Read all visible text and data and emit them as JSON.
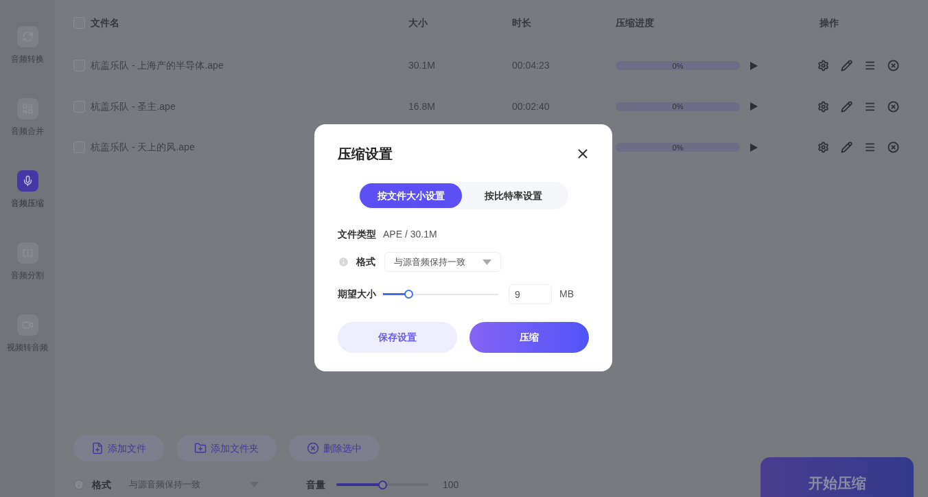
{
  "sidebar": {
    "items": [
      {
        "label": "音频转换",
        "selected": false
      },
      {
        "label": "音频合并",
        "selected": false
      },
      {
        "label": "音频压缩",
        "selected": true
      },
      {
        "label": "音频分割",
        "selected": false
      },
      {
        "label": "视频转音频",
        "selected": false
      }
    ]
  },
  "table": {
    "select_all": {
      "checked": false
    },
    "columns": [
      "文件名",
      "大小",
      "时长",
      "压缩进度",
      "操作"
    ],
    "rows": [
      {
        "checked": false,
        "name": "杭盖乐队 - 上海产的半导体.ape",
        "size": "30.1M",
        "duration": "00:04:23",
        "progress": {
          "level": 0,
          "reading": "0%"
        }
      },
      {
        "checked": false,
        "name": "杭盖乐队 - 圣主.ape",
        "size": "16.8M",
        "duration": "00:02:40",
        "progress": {
          "level": 0,
          "reading": "0%"
        }
      },
      {
        "checked": false,
        "name": "杭盖乐队 - 天上的风.ape",
        "size": "",
        "duration": "",
        "progress": {
          "level": 0,
          "reading": "0%"
        }
      }
    ]
  },
  "toolbar": {
    "buttons": [
      "添加文件",
      "添加文件夹",
      "删除选中"
    ]
  },
  "footer": {
    "format_label": "格式",
    "format_value": "与源音频保持一致",
    "volume_label": "音量",
    "volume": {
      "level": 0.5
    },
    "volume_reading": "100",
    "start_button": "开始压缩"
  },
  "dialog": {
    "title": "压缩设置",
    "tabs": [
      {
        "label": "按文件大小设置",
        "selected": true
      },
      {
        "label": "按比特率设置",
        "selected": false
      }
    ],
    "file_type_label": "文件类型",
    "file_type_value": "APE / 30.1M",
    "format_label": "格式",
    "format_value": "与源音频保持一致",
    "size_label": "期望大小",
    "size_slider": {
      "level": 0.22
    },
    "size_value": "9",
    "size_unit": "MB",
    "buttons": [
      {
        "label": "保存设置",
        "kind": "secondary"
      },
      {
        "label": "压缩",
        "kind": "primary"
      }
    ]
  }
}
